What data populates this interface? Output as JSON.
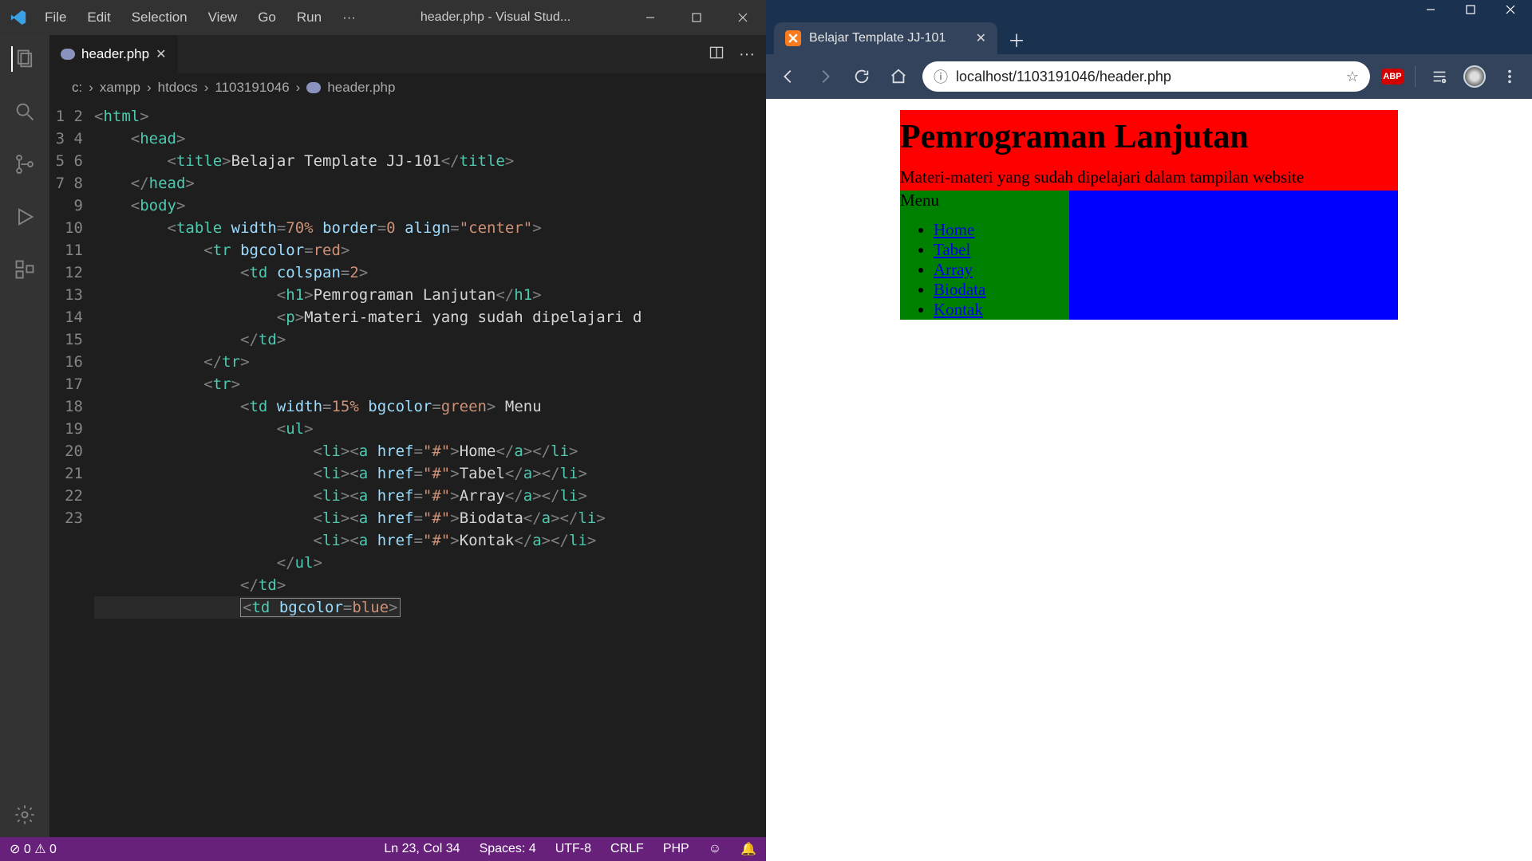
{
  "vscode": {
    "menu": [
      "File",
      "Edit",
      "Selection",
      "View",
      "Go",
      "Run",
      "···"
    ],
    "window_title": "header.php - Visual Stud...",
    "tab": {
      "label": "header.php",
      "icon": "php-icon"
    },
    "breadcrumb": [
      "c:",
      "xampp",
      "htdocs",
      "1103191046",
      "header.php"
    ],
    "lines": [
      1,
      2,
      3,
      4,
      5,
      6,
      7,
      8,
      9,
      10,
      11,
      12,
      13,
      14,
      15,
      16,
      17,
      18,
      19,
      20,
      21,
      22,
      23
    ],
    "code_values": {
      "title_text": "Belajar Template JJ-101",
      "h1_text": "Pemrograman Lanjutan",
      "p_text": "Materi-materi yang sudah dipelajari d",
      "menu_word": " Menu",
      "li": [
        "Home",
        "Tabel",
        "Array",
        "Biodata",
        "Kontak"
      ]
    },
    "status": {
      "errors": "0",
      "warnings": "0",
      "cursor": "Ln 23, Col 34",
      "spaces": "Spaces: 4",
      "encoding": "UTF-8",
      "eol": "CRLF",
      "lang": "PHP"
    }
  },
  "chrome": {
    "tab_title": "Belajar Template JJ-101",
    "url": "localhost/1103191046/header.php",
    "abp": "ABP"
  },
  "page": {
    "h1": "Pemrograman Lanjutan",
    "subtitle": "Materi-materi yang sudah dipelajari dalam tampilan website",
    "menu_label": "Menu",
    "menu_items": [
      "Home",
      "Tabel",
      "Array",
      "Biodata",
      "Kontak"
    ]
  }
}
